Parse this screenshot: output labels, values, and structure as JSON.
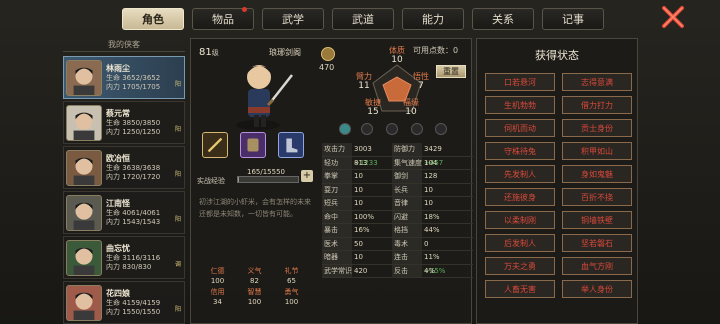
{
  "tabs": [
    {
      "label": "角色",
      "active": true,
      "dot": false
    },
    {
      "label": "物品",
      "active": false,
      "dot": true
    },
    {
      "label": "武学",
      "active": false,
      "dot": false
    },
    {
      "label": "武道",
      "active": false,
      "dot": false
    },
    {
      "label": "能力",
      "active": false,
      "dot": false
    },
    {
      "label": "关系",
      "active": false,
      "dot": false
    },
    {
      "label": "记事",
      "active": false,
      "dot": false
    }
  ],
  "roster": {
    "title": "我的侠客",
    "members": [
      {
        "name": "林雨尘",
        "hp": "生命 3652/3652",
        "mp": "内力 1705/1705",
        "tag": "阳",
        "active": true
      },
      {
        "name": "蔡元常",
        "hp": "生命 3850/3850",
        "mp": "内力 1250/1250",
        "tag": "阳",
        "active": false
      },
      {
        "name": "欧冶恒",
        "hp": "生命 3638/3638",
        "mp": "内力 1720/1720",
        "tag": "阳",
        "active": false
      },
      {
        "name": "江南怪",
        "hp": "生命 4061/4061",
        "mp": "内力 1543/1543",
        "tag": "阳",
        "active": false
      },
      {
        "name": "曲忘忧",
        "hp": "生命 3116/3116",
        "mp": "内力 830/830",
        "tag": "调",
        "active": false
      },
      {
        "name": "花四娘",
        "hp": "生命 4159/4159",
        "mp": "内力 1550/1550",
        "tag": "阳",
        "active": false
      }
    ]
  },
  "character": {
    "level": "81",
    "level_unit": "级",
    "weapon_name": "琅琊剑阁",
    "currency": "470",
    "points_label": "可用点数：0",
    "reset_label": "重置",
    "attrs": [
      {
        "key": "体质",
        "val": "10"
      },
      {
        "key": "臂力",
        "val": "11"
      },
      {
        "key": "悟性",
        "val": "7"
      },
      {
        "key": "敏捷",
        "val": "15"
      },
      {
        "key": "福缘",
        "val": "10"
      }
    ],
    "exp_label": "实战经验",
    "exp_text": "165/15550",
    "exp_fraction": 0.0106,
    "exp_plus": "+",
    "bio": "初涉江湖的小虾米，会有怎样的未来还都是未知数，一切皆有可能。",
    "virtues": [
      {
        "key": "仁德",
        "val": "100"
      },
      {
        "key": "义气",
        "val": "82"
      },
      {
        "key": "礼节",
        "val": "65"
      },
      {
        "key": "信用",
        "val": "34"
      },
      {
        "key": "智慧",
        "val": "100"
      },
      {
        "key": "勇气",
        "val": "100"
      }
    ],
    "stats": [
      [
        {
          "k": "攻击力",
          "v": "3003",
          "b": "+1233"
        },
        {
          "k": "防御力",
          "v": "3429",
          "b": "+457"
        }
      ],
      [
        {
          "k": "轻功",
          "v": "813",
          "b": ""
        },
        {
          "k": "集气速度",
          "v": "104",
          "b": ""
        }
      ],
      [
        {
          "k": "拳掌",
          "v": "10",
          "b": ""
        },
        {
          "k": "御剑",
          "v": "128",
          "b": ""
        }
      ],
      [
        {
          "k": "耍刀",
          "v": "10",
          "b": ""
        },
        {
          "k": "长兵",
          "v": "10",
          "b": ""
        }
      ],
      [
        {
          "k": "短兵",
          "v": "10",
          "b": ""
        },
        {
          "k": "音律",
          "v": "10",
          "b": ""
        }
      ],
      [
        {
          "k": "命中",
          "v": "100%",
          "b": ""
        },
        {
          "k": "闪避",
          "v": "18%",
          "b": ""
        }
      ],
      [
        {
          "k": "暴击",
          "v": "16%",
          "b": ""
        },
        {
          "k": "格挡",
          "v": "44%",
          "b": ""
        }
      ],
      [
        {
          "k": "医术",
          "v": "50",
          "b": ""
        },
        {
          "k": "毒术",
          "v": "0",
          "b": ""
        }
      ],
      [
        {
          "k": "暗器",
          "v": "10",
          "b": ""
        },
        {
          "k": "连击",
          "v": "11%",
          "b": "+15%"
        }
      ],
      [
        {
          "k": "武学常识",
          "v": "420",
          "b": ""
        },
        {
          "k": "反击",
          "v": "4%",
          "b": ""
        }
      ]
    ]
  },
  "status": {
    "title": "获得状态",
    "items": [
      "口若悬河",
      "志得意满",
      "生机勃勃",
      "借力打力",
      "伺机而动",
      "贡士身份",
      "守株待兔",
      "积甲如山",
      "先发制人",
      "身如鬼魅",
      "还施彼身",
      "百折不挠",
      "以柔制刚",
      "铜墙铁壁",
      "后发制人",
      "坚若磐石",
      "万夫之勇",
      "血气方刚",
      "人畜无害",
      "举人身份"
    ]
  },
  "colors": {
    "status_text": "#d84a3a",
    "attr_label": "#e07a4a",
    "bonus": "#5ab05a",
    "active_member": "#3e5a70"
  },
  "icons": {
    "close": "close-x-icon",
    "currency": "coin-icon",
    "weapon_slot": "sword-icon",
    "armor_slot": "armor-icon",
    "boot_slot": "boots-icon"
  }
}
